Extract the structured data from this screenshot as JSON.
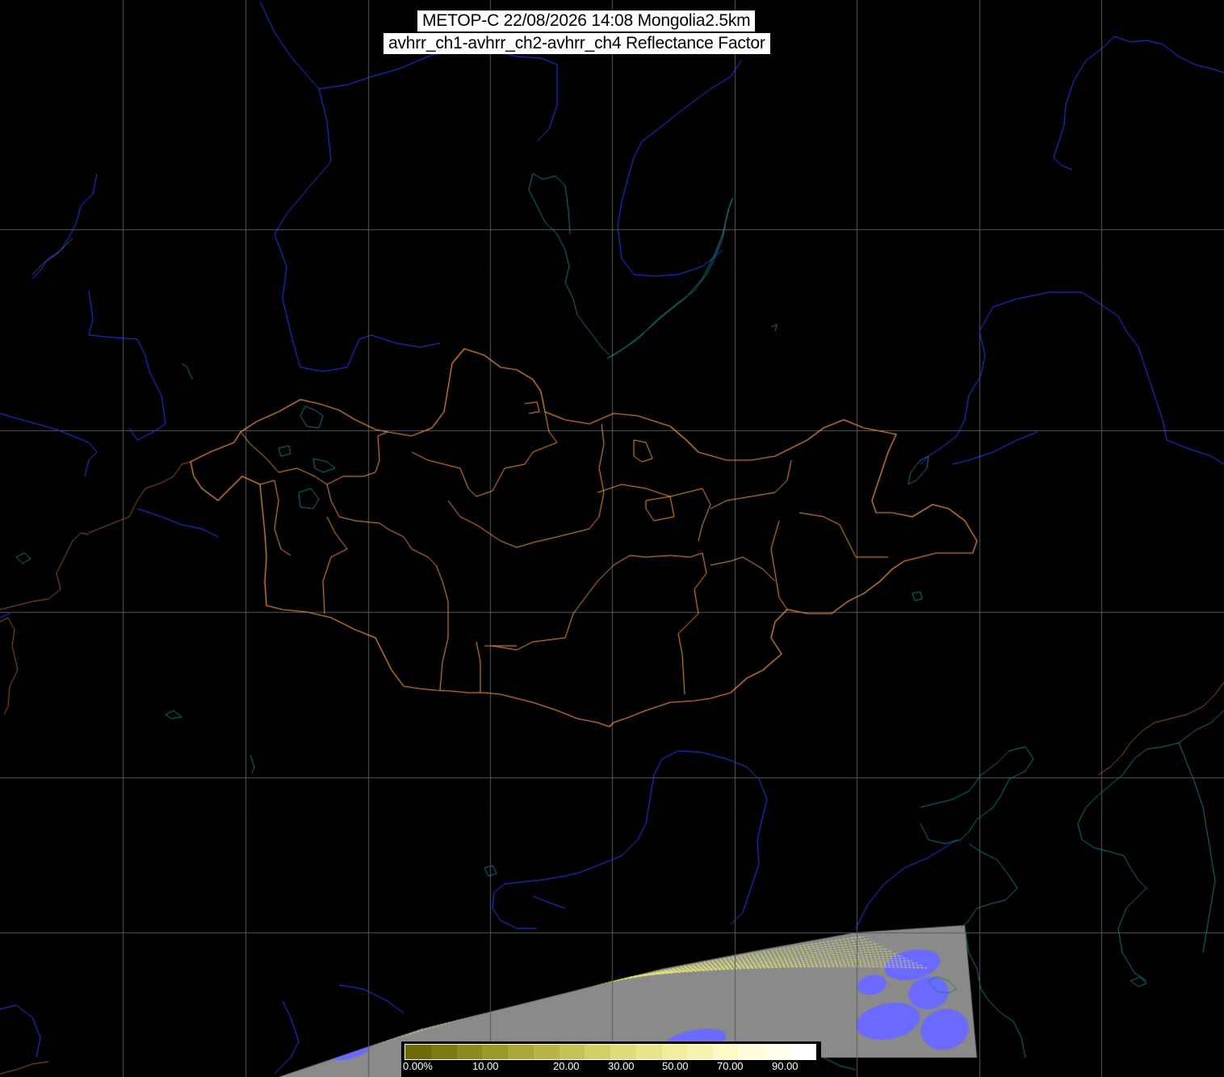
{
  "title": {
    "line1": "METOP-C 22/08/2026 14:08 Mongolia2.5km",
    "line2": "avhrr_ch1-avhrr_ch2-avhrr_ch4 Reflectance Factor"
  },
  "colorbar": {
    "ticks": [
      "0.00%",
      "10.00",
      "20.00",
      "30.00",
      "50.00",
      "70.00",
      "90.00"
    ],
    "colors": [
      "#6e6b0a",
      "#7d7a14",
      "#8c891e",
      "#9b982a",
      "#aaa737",
      "#b8b546",
      "#c6c356",
      "#d3d067",
      "#dedb78",
      "#e8e58a",
      "#f0ee9c",
      "#f6f4b0",
      "#fbfac4",
      "#fefdd8",
      "#ffffea",
      "#ffffff"
    ]
  },
  "map": {
    "background_color": "#000000",
    "graticule_color": "#5a5a5a",
    "river_color": "#2d3bff",
    "coastline_lake_color": "#1e7a80",
    "mongolia_border_color": "#f39a4a",
    "china_border_color": "#9a5a2a",
    "swath_gray": "#8a8a8a",
    "swath_cloud_blue": "#6a6aff",
    "swath_edge_yellow": "#e6e87a"
  }
}
